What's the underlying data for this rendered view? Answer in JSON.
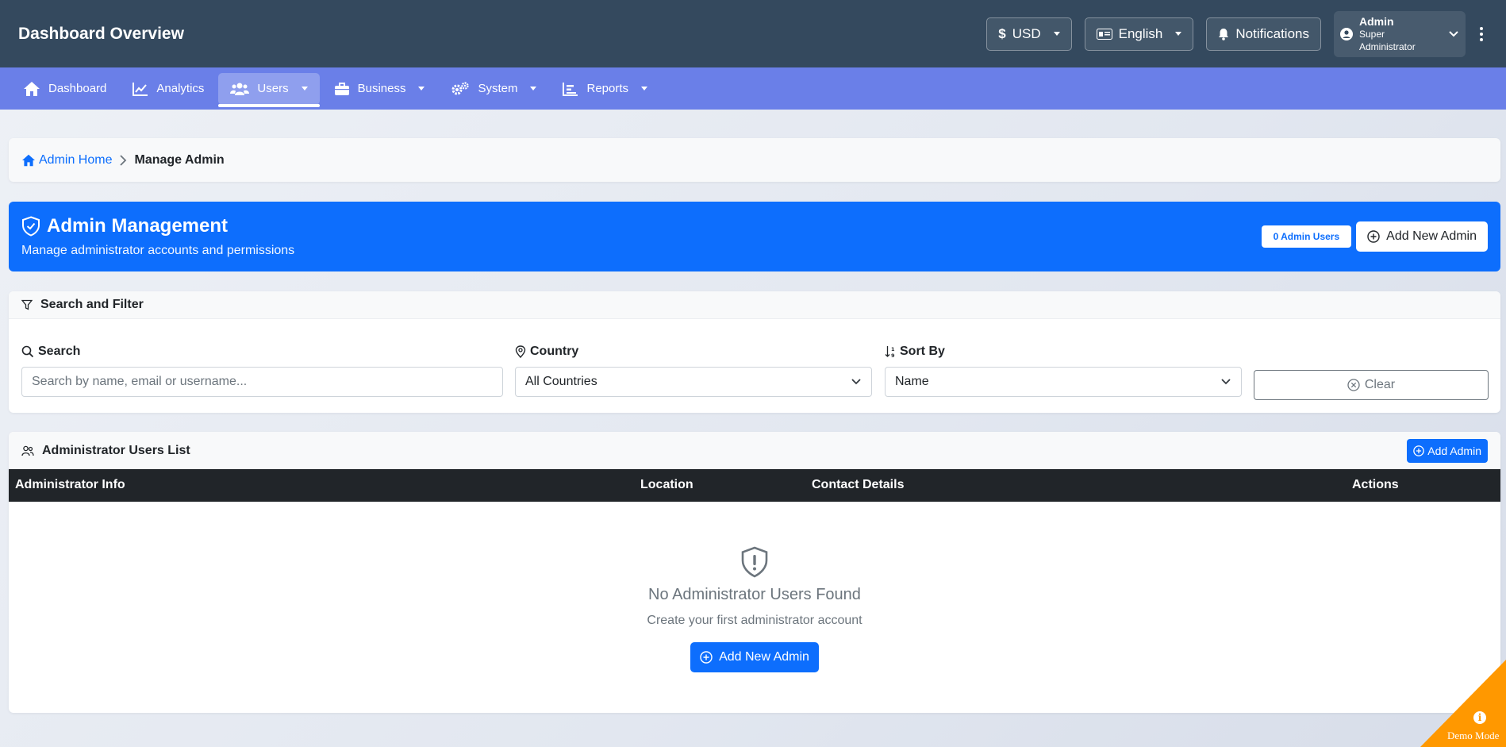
{
  "header": {
    "title": "Dashboard Overview",
    "currency": "USD",
    "language": "English",
    "notifications": "Notifications",
    "user_name": "Admin",
    "user_role": "Super Administrator"
  },
  "nav": {
    "items": [
      {
        "label": "Dashboard",
        "icon": "home-icon"
      },
      {
        "label": "Analytics",
        "icon": "chart-line-icon"
      },
      {
        "label": "Users",
        "icon": "users-icon",
        "active": true
      },
      {
        "label": "Business",
        "icon": "briefcase-icon"
      },
      {
        "label": "System",
        "icon": "gears-icon"
      },
      {
        "label": "Reports",
        "icon": "bar-chart-icon"
      }
    ]
  },
  "breadcrumb": {
    "home": "Admin Home",
    "current": "Manage Admin"
  },
  "banner": {
    "title": "Admin Management",
    "subtitle": "Manage administrator accounts and permissions",
    "badge": "0 Admin Users",
    "add_button": "Add New Admin"
  },
  "filter": {
    "heading": "Search and Filter",
    "search_label": "Search",
    "search_placeholder": "Search by name, email or username...",
    "country_label": "Country",
    "country_value": "All Countries",
    "sort_label": "Sort By",
    "sort_value": "Name",
    "clear": "Clear"
  },
  "list": {
    "heading": "Administrator Users List",
    "add_button": "Add Admin",
    "columns": [
      "Administrator Info",
      "Location",
      "Contact Details",
      "Actions"
    ],
    "empty_title": "No Administrator Users Found",
    "empty_sub": "Create your first administrator account",
    "empty_button": "Add New Admin"
  },
  "demo": {
    "label": "Demo Mode"
  },
  "colors": {
    "header_bg": "#34495e",
    "nav_bg": "#6a7fe8",
    "primary": "#0d6efd",
    "table_head": "#212529",
    "demo": "#ff9800"
  }
}
